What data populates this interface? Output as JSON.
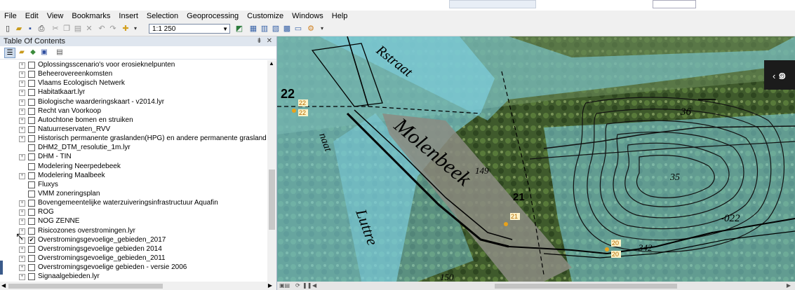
{
  "menubar": [
    "File",
    "Edit",
    "View",
    "Bookmarks",
    "Insert",
    "Selection",
    "Geoprocessing",
    "Customize",
    "Windows",
    "Help"
  ],
  "toolbar": {
    "scale_value": "1:1 250"
  },
  "toc": {
    "title": "Table Of Contents",
    "close": "✕",
    "layers": [
      {
        "label": "Oplossingsscenario's voor erosieknelpunten",
        "expandable": true,
        "checked": false
      },
      {
        "label": "Beheerovereenkomsten",
        "expandable": true,
        "checked": false
      },
      {
        "label": "Vlaams Ecologisch Netwerk",
        "expandable": true,
        "checked": false
      },
      {
        "label": "Habitatkaart.lyr",
        "expandable": true,
        "checked": false
      },
      {
        "label": "Biologische waarderingskaart - v2014.lyr",
        "expandable": true,
        "checked": false
      },
      {
        "label": "Recht van Voorkoop",
        "expandable": true,
        "checked": false
      },
      {
        "label": "Autochtone bomen en struiken",
        "expandable": true,
        "checked": false
      },
      {
        "label": "Natuurreservaten_RVV",
        "expandable": true,
        "checked": false
      },
      {
        "label": "Historisch permanente graslanden(HPG) en andere permanente graslanden in Vlaan",
        "expandable": true,
        "checked": false
      },
      {
        "label": "DHM2_DTM_resolutie_1m.lyr",
        "expandable": false,
        "checked": false
      },
      {
        "label": "DHM - TIN",
        "expandable": true,
        "checked": false
      },
      {
        "label": "Modelering Neerpedebeek",
        "expandable": false,
        "checked": false
      },
      {
        "label": "Modelering Maalbeek",
        "expandable": true,
        "checked": false
      },
      {
        "label": "Fluxys",
        "expandable": false,
        "checked": false
      },
      {
        "label": "VMM zoneringsplan",
        "expandable": false,
        "checked": false
      },
      {
        "label": "Bovengemeentelijke waterzuiveringsinfrastructuur Aquafin",
        "expandable": true,
        "checked": false
      },
      {
        "label": "ROG",
        "expandable": true,
        "checked": false
      },
      {
        "label": "NOG ZENNE",
        "expandable": true,
        "checked": false
      },
      {
        "label": "Risicozones overstromingen.lyr",
        "expandable": true,
        "checked": false
      },
      {
        "label": "Overstromingsgevoelige_gebieden_2017",
        "expandable": true,
        "checked": true
      },
      {
        "label": "Overstromingsgevoelige gebieden 2014",
        "expandable": true,
        "checked": false
      },
      {
        "label": "Overstromingsgevoelige_gebieden_2011",
        "expandable": true,
        "checked": false
      },
      {
        "label": "Overstromingsgevoelige gebieden - versie 2006",
        "expandable": true,
        "checked": false
      },
      {
        "label": "Signaalgebieden.lyr",
        "expandable": true,
        "checked": false
      }
    ]
  },
  "map": {
    "labels": {
      "street_top": "Rstraat",
      "stream": "Molenbeek",
      "luttre": "Luttre",
      "naat": "naat",
      "num_22": "22",
      "num_21": "21",
      "num_36": "36",
      "num_35": "35",
      "num_149": "149",
      "num_022": "-022",
      "num_342": "342",
      "num_150": "150"
    },
    "markers": [
      "22",
      "22",
      "21",
      "20",
      "20"
    ],
    "colors": {
      "flood": "#7fd3e6",
      "marker": "#e8a21a"
    }
  }
}
